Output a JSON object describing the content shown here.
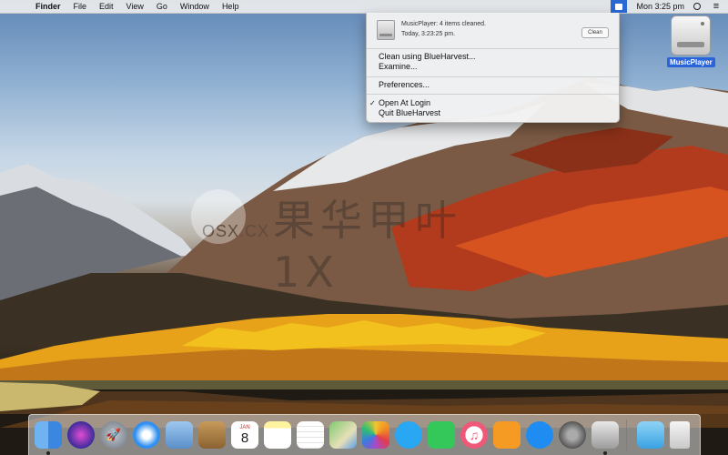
{
  "menubar": {
    "app_name": "Finder",
    "items": [
      "File",
      "Edit",
      "View",
      "Go",
      "Window",
      "Help"
    ],
    "clock": "Mon 3:25 pm"
  },
  "dropdown": {
    "notification": {
      "title": "MusicPlayer: 4 items cleaned.",
      "time": "Today,  3:23:25 pm.",
      "button": "Clean"
    },
    "items": {
      "clean_using": "Clean using BlueHarvest...",
      "examine": "Examine...",
      "preferences": "Preferences...",
      "open_at_login": "Open At Login",
      "quit": "Quit BlueHarvest"
    },
    "check_mark": "✓"
  },
  "desktop": {
    "drive_label": "MusicPlayer",
    "watermark_text": "OSX.CX"
  },
  "dock": {
    "calendar_month": "JAN",
    "calendar_day": "8"
  },
  "colors": {
    "accent": "#2b63d8"
  }
}
